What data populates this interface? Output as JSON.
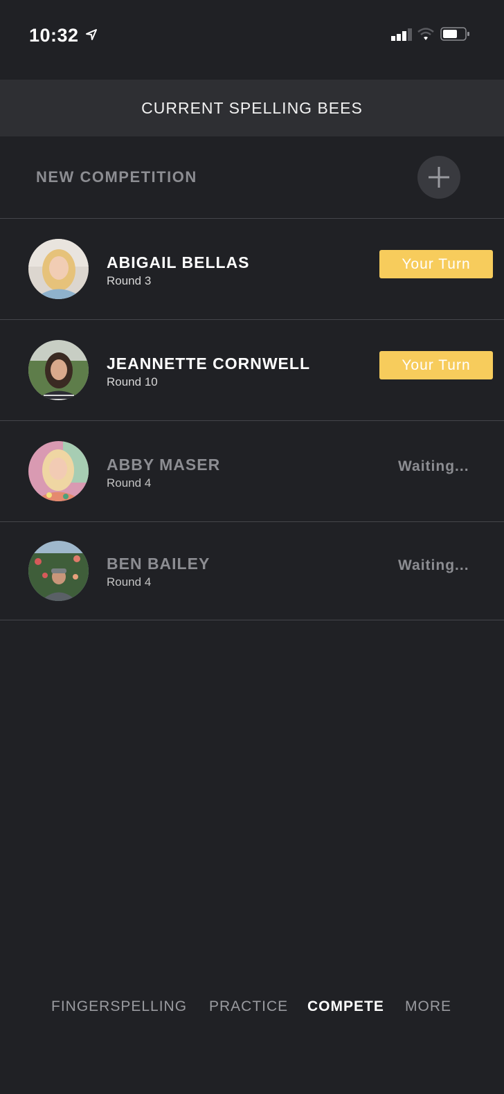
{
  "status_bar": {
    "time": "10:32"
  },
  "header": {
    "title": "CURRENT SPELLING BEES"
  },
  "new_competition": {
    "label": "NEW COMPETITION"
  },
  "competitions": [
    {
      "name": "ABIGAIL BELLAS",
      "round": "Round 3",
      "status": "Your Turn"
    },
    {
      "name": "JEANNETTE CORNWELL",
      "round": "Round 10",
      "status": "Your Turn"
    },
    {
      "name": "ABBY MASER",
      "round": "Round 4",
      "status": "Waiting..."
    },
    {
      "name": "BEN BAILEY",
      "round": "Round 4",
      "status": "Waiting..."
    }
  ],
  "tabs": [
    {
      "label": "FINGERSPELLING",
      "active": false
    },
    {
      "label": "PRACTICE",
      "active": false
    },
    {
      "label": "COMPETE",
      "active": true
    },
    {
      "label": "MORE",
      "active": false
    }
  ],
  "colors": {
    "background": "#202125",
    "header": "#2e2f33",
    "accent": "#f7cc5c",
    "muted_text": "#8c8d92"
  }
}
